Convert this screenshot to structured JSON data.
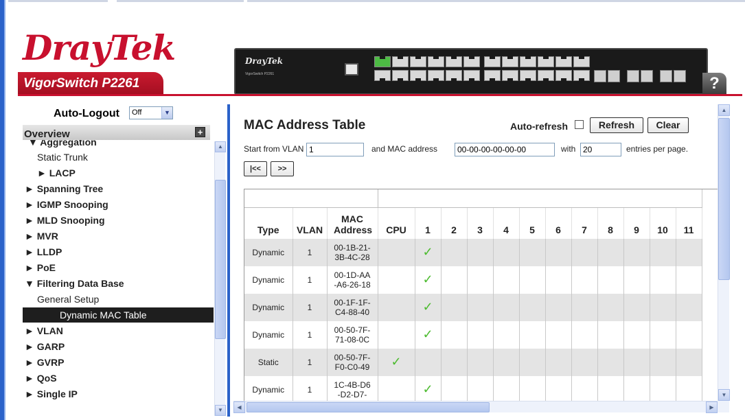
{
  "brand": {
    "logo_main": "Dray",
    "logo_tek": "Tek",
    "model": "VigorSwitch P2261",
    "device_logo": "DrayTek",
    "device_model": "VigorSwitch P2261",
    "help_label": "?"
  },
  "nav": {
    "autologout_label": "Auto-Logout",
    "autologout_value": "Off",
    "overview_label": "Overview",
    "items": [
      {
        "label": "▼ Aggregation",
        "bold": true
      },
      {
        "label": "Static Trunk",
        "bold": false
      },
      {
        "label": "► LACP",
        "bold": true
      },
      {
        "label": "► Spanning Tree",
        "bold": true
      },
      {
        "label": "► IGMP Snooping",
        "bold": true
      },
      {
        "label": "► MLD Snooping",
        "bold": true
      },
      {
        "label": "► MVR",
        "bold": true
      },
      {
        "label": "► LLDP",
        "bold": true
      },
      {
        "label": "► PoE",
        "bold": true
      },
      {
        "label": "▼ Filtering Data Base",
        "bold": true
      },
      {
        "label": "General Setup",
        "bold": false
      },
      {
        "label": "Dynamic MAC Table",
        "bold": false,
        "selected": true
      },
      {
        "label": "► VLAN",
        "bold": true
      },
      {
        "label": "► GARP",
        "bold": true
      },
      {
        "label": "► GVRP",
        "bold": true
      },
      {
        "label": "► QoS",
        "bold": true
      },
      {
        "label": "► Single IP",
        "bold": true
      }
    ]
  },
  "main": {
    "title": "MAC Address Table",
    "auto_refresh_label": "Auto-refresh",
    "auto_refresh_checked": false,
    "refresh_label": "Refresh",
    "clear_label": "Clear",
    "start_vlan_label": "Start from VLAN",
    "start_vlan_value": "1",
    "mac_label": "and MAC address",
    "mac_value": "00-00-00-00-00-00",
    "with_label": "with",
    "entries_value": "20",
    "entries_label": "entries per page.",
    "first_label": "|<<",
    "next_label": ">>"
  },
  "table": {
    "headers": [
      "Type",
      "VLAN",
      "MAC Address",
      "CPU",
      "1",
      "2",
      "3",
      "4",
      "5",
      "6",
      "7",
      "8",
      "9",
      "10",
      "11"
    ],
    "rows": [
      {
        "type": "Dynamic",
        "vlan": "1",
        "mac": [
          "00-1B-21-",
          "3B-4C-28"
        ],
        "cpu": false,
        "port1": true
      },
      {
        "type": "Dynamic",
        "vlan": "1",
        "mac": [
          "00-1D-AA",
          "-A6-26-18"
        ],
        "cpu": false,
        "port1": true
      },
      {
        "type": "Dynamic",
        "vlan": "1",
        "mac": [
          "00-1F-1F-",
          "C4-88-40"
        ],
        "cpu": false,
        "port1": true
      },
      {
        "type": "Dynamic",
        "vlan": "1",
        "mac": [
          "00-50-7F-",
          "71-08-0C"
        ],
        "cpu": false,
        "port1": true
      },
      {
        "type": "Static",
        "vlan": "1",
        "mac": [
          "00-50-7F-",
          "F0-C0-49"
        ],
        "cpu": true,
        "port1": false
      },
      {
        "type": "Dynamic",
        "vlan": "1",
        "mac": [
          "1C-4B-D6",
          "-D2-D7-"
        ],
        "cpu": false,
        "port1": true
      }
    ],
    "check_glyph": "✓"
  },
  "colors": {
    "brand_red": "#c8102e",
    "frame_blue": "#2b62c9",
    "check_green": "#4cbb2f"
  }
}
